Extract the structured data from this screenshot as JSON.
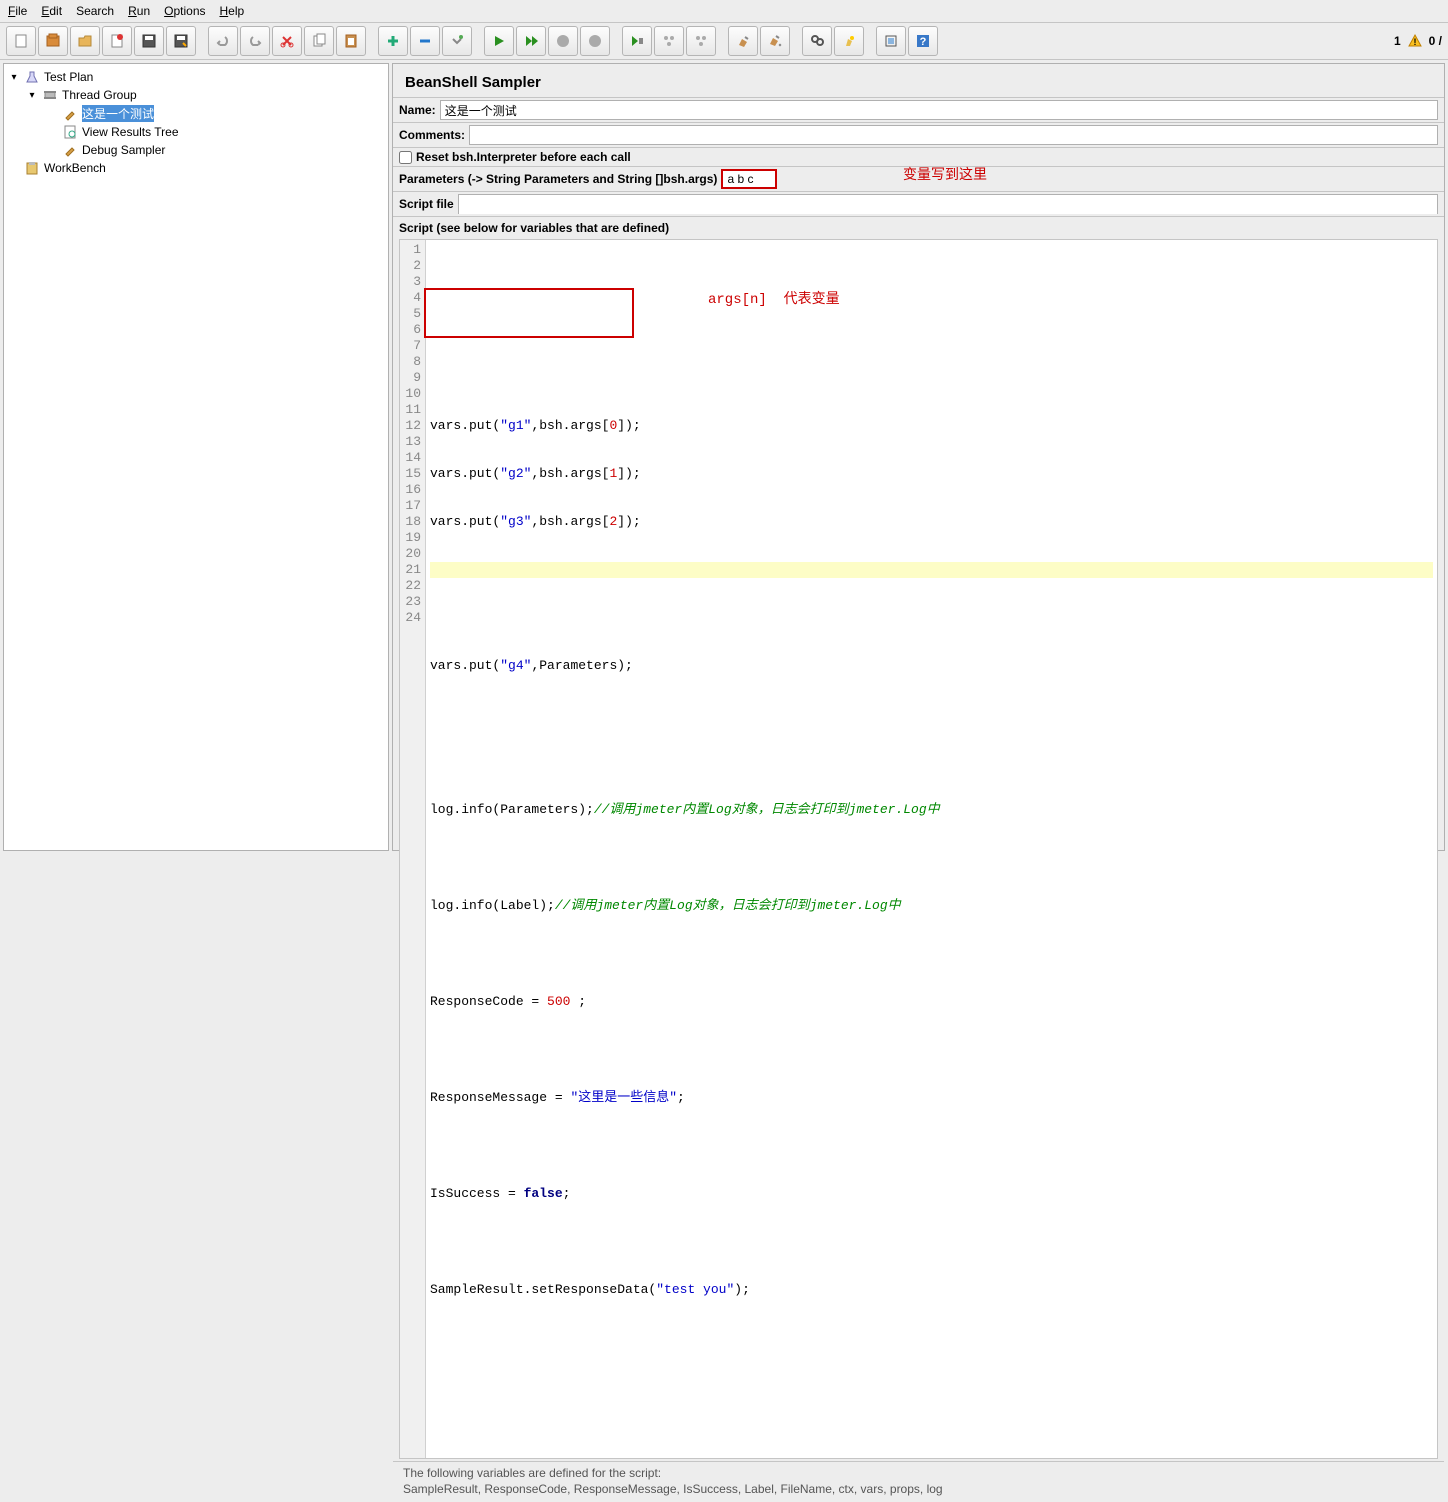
{
  "menu": {
    "file": "File",
    "edit": "Edit",
    "search": "Search",
    "run": "Run",
    "options": "Options",
    "help": "Help"
  },
  "status": {
    "count": "1",
    "ratio": "0 /"
  },
  "tree": {
    "testplan": "Test Plan",
    "threadgroup": "Thread Group",
    "sampler1": "这是一个测试",
    "viewresults": "View Results Tree",
    "debugsampler": "Debug Sampler",
    "workbench": "WorkBench"
  },
  "panel": {
    "title": "BeanShell Sampler",
    "name_label": "Name:",
    "name_value": "这是一个测试",
    "comments_label": "Comments:",
    "comments_value": "",
    "reset_label": "Reset bsh.Interpreter before each call",
    "params_label": "Parameters (-> String Parameters and String []bsh.args)",
    "params_value": "a b c",
    "scriptfile_label": "Script file",
    "scriptfile_value": "",
    "script_label": "Script (see below for variables that are defined)"
  },
  "annot": {
    "params": "变量写到这里",
    "args": "args[n]  代表变量"
  },
  "code": {
    "l4": {
      "a": "vars.put(",
      "s": "\"g1\"",
      "b": ",bsh.args[",
      "n": "0",
      "c": "]);"
    },
    "l5": {
      "a": "vars.put(",
      "s": "\"g2\"",
      "b": ",bsh.args[",
      "n": "1",
      "c": "]);"
    },
    "l6": {
      "a": "vars.put(",
      "s": "\"g3\"",
      "b": ",bsh.args[",
      "n": "2",
      "c": "]);"
    },
    "l9": {
      "a": "vars.put(",
      "s": "\"g4\"",
      "b": ",Parameters);"
    },
    "l12": {
      "a": "log.info(Parameters);",
      "c": "//调用jmeter内置Log对象，日志会打印到jmeter.Log中"
    },
    "l14": {
      "a": "log.info(Label);",
      "c": "//调用jmeter内置Log对象，日志会打印到jmeter.Log中"
    },
    "l16": {
      "a": "ResponseCode = ",
      "n": "500",
      "b": " ;"
    },
    "l18": {
      "a": "ResponseMessage = ",
      "s": "\"这里是一些信息\"",
      "b": ";"
    },
    "l20": {
      "a": "IsSuccess = ",
      "k": "false",
      "b": ";"
    },
    "l22": {
      "a": "SampleResult.setResponseData(",
      "s": "\"test you\"",
      "b": ");"
    }
  },
  "footer": {
    "line1": "The following variables are defined for the script:",
    "line2": "SampleResult, ResponseCode, ResponseMessage, IsSuccess, Label, FileName, ctx, vars, props, log"
  }
}
